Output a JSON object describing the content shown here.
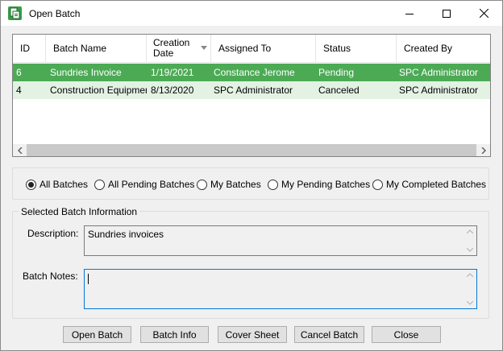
{
  "window": {
    "title": "Open Batch",
    "icons": {
      "app": "batch-app-icon",
      "minimize": "minimize-icon",
      "maximize": "maximize-icon",
      "close": "close-icon"
    }
  },
  "grid": {
    "columns": [
      "ID",
      "Batch Name",
      "Creation Date",
      "Assigned To",
      "Status",
      "Created By"
    ],
    "rows": [
      {
        "id": "6",
        "batch_name": "Sundries Invoice",
        "creation_date": "1/19/2021",
        "assigned_to": "Constance Jerome",
        "status": "Pending",
        "created_by": "SPC Administrator"
      },
      {
        "id": "4",
        "batch_name": "Construction Equipmen...",
        "creation_date": "8/13/2020",
        "assigned_to": "SPC Administrator",
        "status": "Canceled",
        "created_by": "SPC Administrator"
      }
    ],
    "colors": {
      "selected_row": "#4caa55",
      "alt_row": "#e3f2e3"
    }
  },
  "filters": {
    "options": [
      "All Batches",
      "All Pending Batches",
      "My Batches",
      "My Pending Batches",
      "My Completed Batches"
    ],
    "selected": "All Batches"
  },
  "info": {
    "legend": "Selected Batch Information",
    "description_label": "Description:",
    "description_value": "Sundries invoices",
    "notes_label": "Batch Notes:",
    "notes_value": ""
  },
  "buttons": {
    "open_batch": "Open Batch",
    "batch_info": "Batch Info",
    "cover_sheet": "Cover Sheet",
    "cancel_batch": "Cancel Batch",
    "close": "Close"
  }
}
